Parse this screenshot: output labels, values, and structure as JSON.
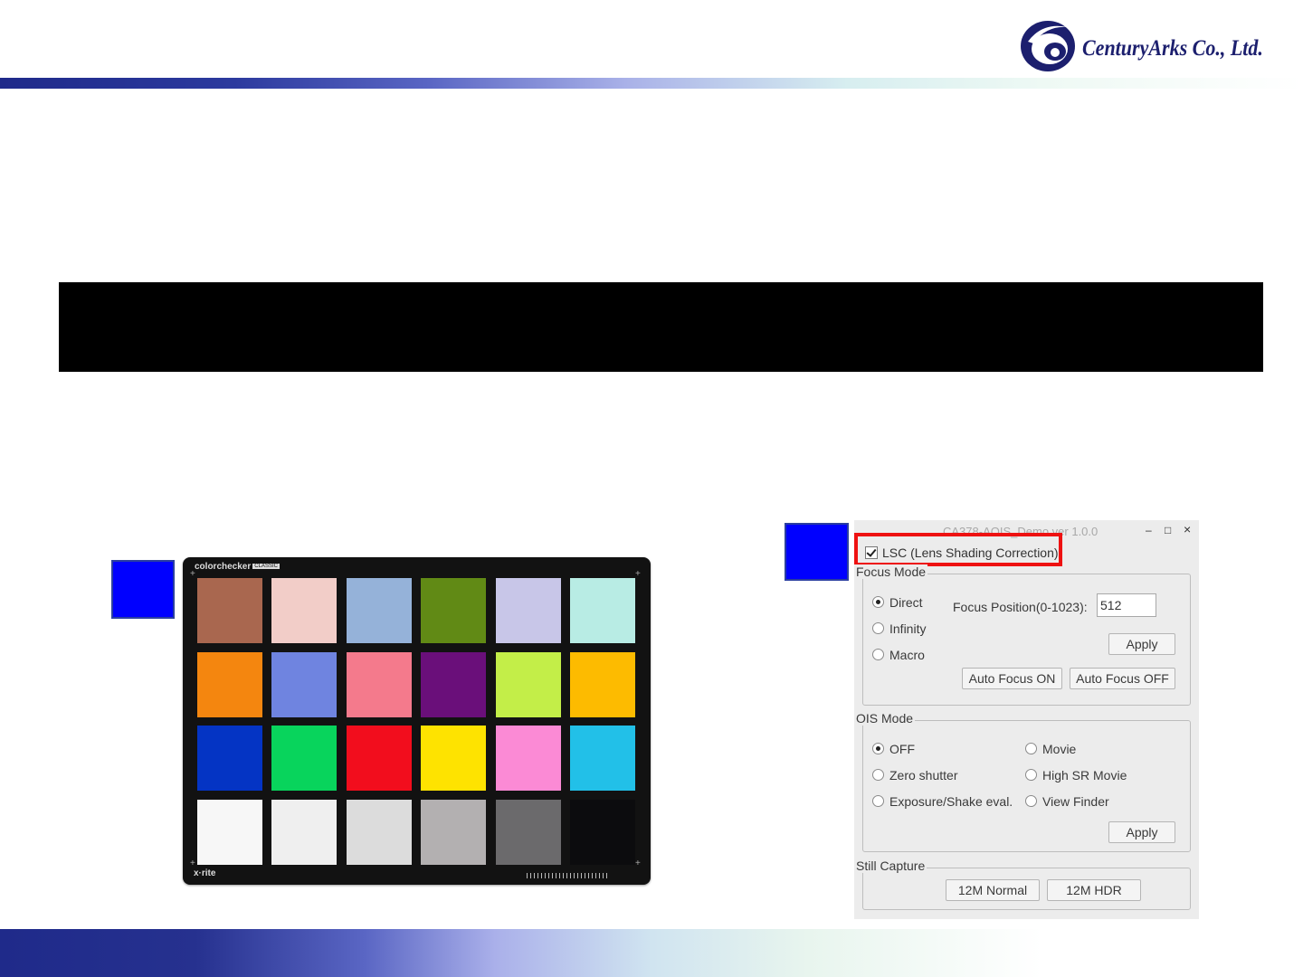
{
  "header": {
    "company_name": "CenturyArks Co., Ltd.",
    "brand_colors": {
      "navy": "#1c1f6e",
      "band_start": "#1f2a8a"
    }
  },
  "checker_card": {
    "brand": "colorchecker",
    "edition": "CLASSIC",
    "maker": "x·rite",
    "patches": [
      [
        "#a9674f",
        "#f2cdc8",
        "#95b2d9",
        "#618a15",
        "#c8c6e8",
        "#b8ece4"
      ],
      [
        "#f4860f",
        "#6f84e0",
        "#f47a8c",
        "#6a0f7a",
        "#c3ee48",
        "#fdbb00"
      ],
      [
        "#0434c4",
        "#08d45c",
        "#f20d1d",
        "#fee300",
        "#fb8ad5",
        "#22c0e8"
      ],
      [
        "#f7f7f7",
        "#efefef",
        "#dcdcdc",
        "#b3b0b1",
        "#6b6a6c",
        "#0c0c0e"
      ]
    ]
  },
  "app": {
    "title": "CA378-AOIS_Demo  ver 1.0.0",
    "controls": {
      "minimize": "–",
      "maximize": "□",
      "close": "×"
    },
    "lsc": {
      "label": "LSC (Lens Shading Correction)",
      "checked": true,
      "highlight_color": "#ee1111"
    },
    "focus": {
      "group_label": "Focus Mode",
      "options": [
        "Direct",
        "Infinity",
        "Macro"
      ],
      "selected": "Direct",
      "position_label": "Focus Position(0-1023):",
      "position_value": "512",
      "apply": "Apply",
      "af_on": "Auto Focus ON",
      "af_off": "Auto Focus OFF"
    },
    "ois": {
      "group_label": "OIS Mode",
      "left_options": [
        "OFF",
        "Zero shutter",
        "Exposure/Shake eval."
      ],
      "right_options": [
        "Movie",
        "High SR Movie",
        "View Finder"
      ],
      "selected": "OFF",
      "apply": "Apply"
    },
    "still": {
      "group_label": "Still Capture",
      "normal": "12M Normal",
      "hdr": "12M HDR"
    }
  }
}
